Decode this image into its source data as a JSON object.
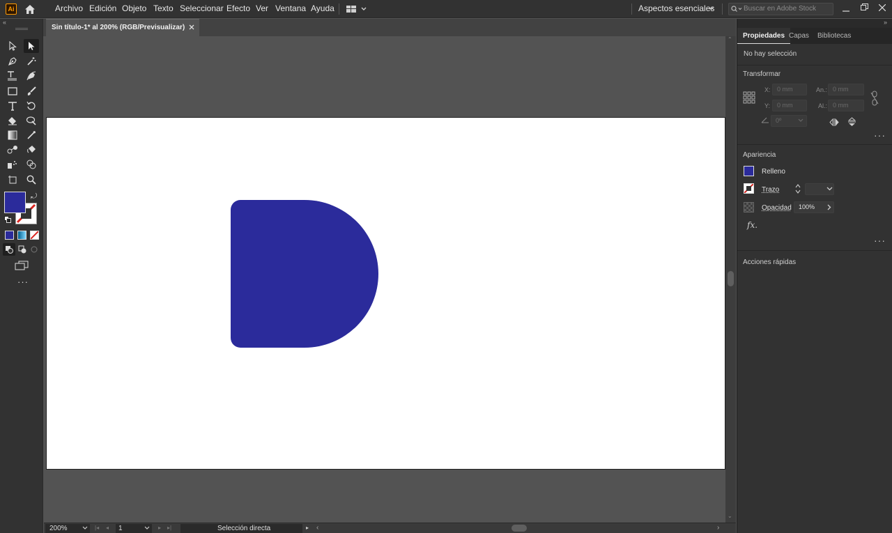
{
  "app": {
    "logo_text": "Ai",
    "brand_color": "#ff9a00"
  },
  "menu": {
    "items": [
      "Archivo",
      "Edición",
      "Objeto",
      "Texto",
      "Seleccionar",
      "Efecto",
      "Ver",
      "Ventana",
      "Ayuda"
    ],
    "workspace": "Aspectos esenciales",
    "search_placeholder": "Buscar en Adobe Stock"
  },
  "document": {
    "tab_title": "Sin título-1* al 200% (RGB/Previsualizar)",
    "shape_color": "#2b2b9b"
  },
  "status": {
    "zoom": "200%",
    "page": "1",
    "tool_name": "Selección directa"
  },
  "panel": {
    "tabs": [
      "Propiedades",
      "Capas",
      "Bibliotecas"
    ],
    "no_selection": "No hay selección",
    "transform": {
      "title": "Transformar",
      "x_label": "X:",
      "x_value": "0 mm",
      "y_label": "Y:",
      "y_value": "0 mm",
      "w_label": "An.:",
      "w_value": "0 mm",
      "h_label": "Al.:",
      "h_value": "0 mm",
      "angle_value": "0º"
    },
    "appearance": {
      "title": "Apariencia",
      "fill_label": "Relleno",
      "fill_color": "#2b2b9b",
      "stroke_label": "Trazo",
      "opacity_label": "Opacidad",
      "opacity_value": "100%",
      "fx_label": "fx."
    },
    "quick_actions": {
      "title": "Acciones rápidas"
    }
  }
}
